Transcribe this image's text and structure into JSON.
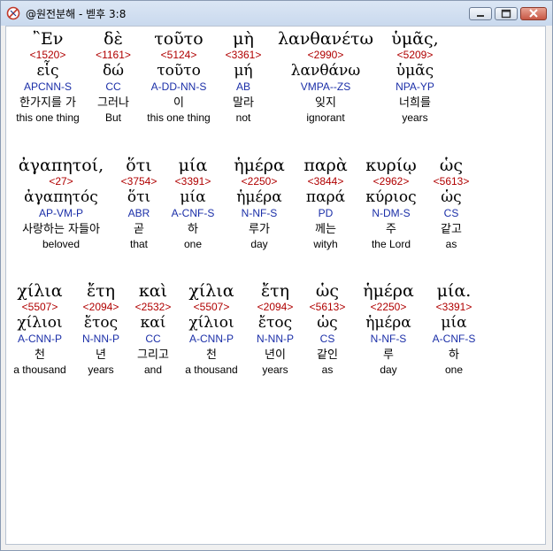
{
  "window": {
    "title": "@원전분해 - 벧후 3:8",
    "buttons": {
      "minimize": "—",
      "maximize": "□",
      "close": "✕"
    }
  },
  "rows": [
    {
      "words": [
        {
          "greek": "῍Εν",
          "strong": "<1520>",
          "lemma": "εἷς",
          "parse": "APCNN-S",
          "korean": "한가지를 가",
          "english": "this one thing"
        },
        {
          "greek": "δὲ",
          "strong": "<1161>",
          "lemma": "δώ",
          "parse": "CC",
          "korean": "그러나",
          "english": "But"
        },
        {
          "greek": "τοῦτο",
          "strong": "<5124>",
          "lemma": "τοῦτο",
          "parse": "A-DD-NN-S",
          "korean": "이",
          "english": "this one thing"
        },
        {
          "greek": "μὴ",
          "strong": "<3361>",
          "lemma": "μή",
          "parse": "AB",
          "korean": "말라",
          "english": "not"
        },
        {
          "greek": "λανθανέτω",
          "strong": "<2990>",
          "lemma": "λανθάνω",
          "parse": "VMPA--ZS",
          "korean": "잊지",
          "english": "ignorant"
        },
        {
          "greek": "ὑμᾶς,",
          "strong": "<5209>",
          "lemma": "ὑμᾶς",
          "parse": "NPA-YP",
          "korean": "너희를",
          "english": "years"
        }
      ]
    },
    {
      "words": [
        {
          "greek": "ἀγαπητοί,",
          "strong": "<27>",
          "lemma": "ἀγαπητός",
          "parse": "AP-VM-P",
          "korean": "사랑하는 자들아",
          "english": "beloved"
        },
        {
          "greek": "ὅτι",
          "strong": "<3754>",
          "lemma": "ὅτι",
          "parse": "ABR",
          "korean": "곧",
          "english": "that"
        },
        {
          "greek": "μία",
          "strong": "<3391>",
          "lemma": "μία",
          "parse": "A-CNF-S",
          "korean": "하",
          "english": "one"
        },
        {
          "greek": "ἡμέρα",
          "strong": "<2250>",
          "lemma": "ἡμέρα",
          "parse": "N-NF-S",
          "korean": "루가",
          "english": "day"
        },
        {
          "greek": "παρὰ",
          "strong": "<3844>",
          "lemma": "παρά",
          "parse": "PD",
          "korean": "께는",
          "english": "wityh"
        },
        {
          "greek": "κυρίῳ",
          "strong": "<2962>",
          "lemma": "κύριος",
          "parse": "N-DM-S",
          "korean": "주",
          "english": "the Lord"
        },
        {
          "greek": "ὡς",
          "strong": "<5613>",
          "lemma": "ὡς",
          "parse": "CS",
          "korean": "같고",
          "english": "as"
        }
      ]
    },
    {
      "words": [
        {
          "greek": "χίλια",
          "strong": "<5507>",
          "lemma": "χίλιοι",
          "parse": "A-CNN-P",
          "korean": "천",
          "english": "a thousand"
        },
        {
          "greek": "ἔτη",
          "strong": "<2094>",
          "lemma": "ἔτος",
          "parse": "N-NN-P",
          "korean": "년",
          "english": "years"
        },
        {
          "greek": "καὶ",
          "strong": "<2532>",
          "lemma": "καί",
          "parse": "CC",
          "korean": "그리고",
          "english": "and"
        },
        {
          "greek": "χίλια",
          "strong": "<5507>",
          "lemma": "χίλιοι",
          "parse": "A-CNN-P",
          "korean": "천",
          "english": "a thousand"
        },
        {
          "greek": "ἔτη",
          "strong": "<2094>",
          "lemma": "ἔτος",
          "parse": "N-NN-P",
          "korean": "년이",
          "english": "years"
        },
        {
          "greek": "ὡς",
          "strong": "<5613>",
          "lemma": "ὡς",
          "parse": "CS",
          "korean": "같인",
          "english": "as"
        },
        {
          "greek": "ἡμέρα",
          "strong": "<2250>",
          "lemma": "ἡμέρα",
          "parse": "N-NF-S",
          "korean": "루",
          "english": "day"
        },
        {
          "greek": "μία.",
          "strong": "<3391>",
          "lemma": "μία",
          "parse": "A-CNF-S",
          "korean": "하",
          "english": "one"
        }
      ]
    }
  ]
}
